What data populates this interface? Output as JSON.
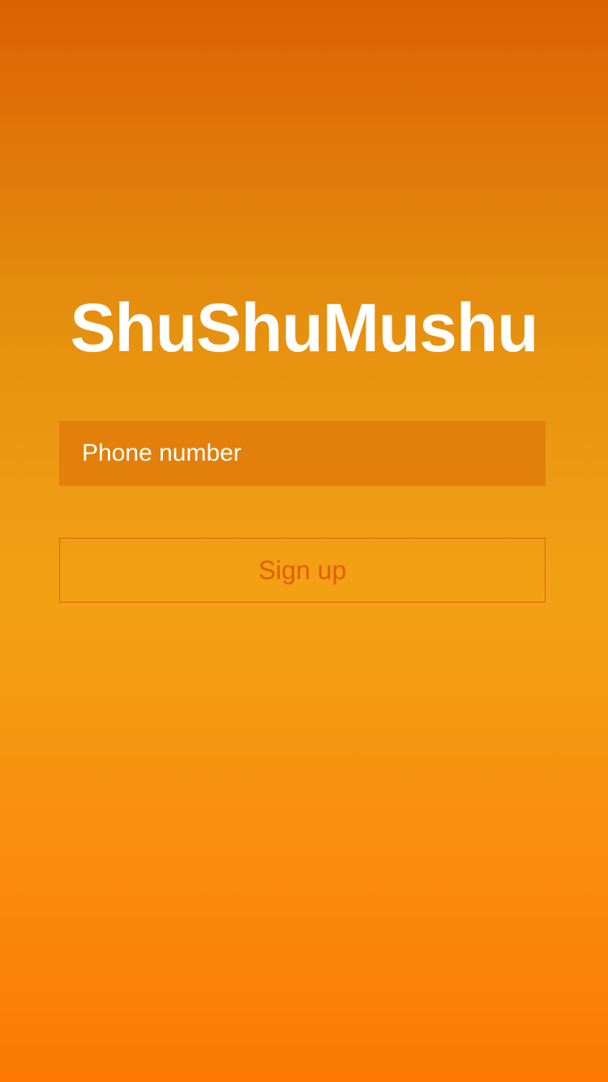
{
  "app": {
    "title": "ShuShuMushu"
  },
  "form": {
    "phone_placeholder": "Phone number",
    "phone_value": "",
    "signup_label": "Sign up"
  },
  "colors": {
    "gradient_top": "#db6202",
    "gradient_mid": "#f3a114",
    "gradient_bottom": "#fd7805",
    "field_background": "#e37f0b",
    "button_border": "#e0610a",
    "button_text": "#e35d09",
    "title_text": "#ffffff"
  }
}
